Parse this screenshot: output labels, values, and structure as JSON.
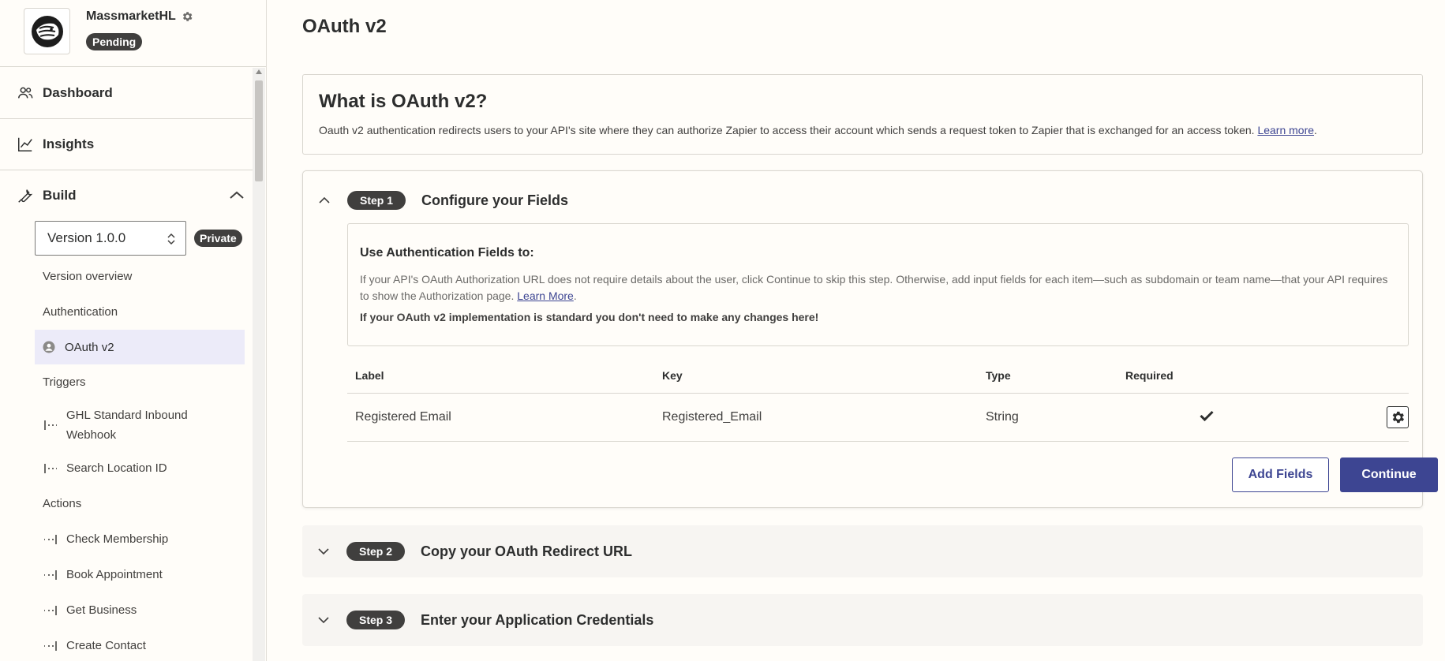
{
  "app": {
    "name": "MassmarketHL",
    "status": "Pending"
  },
  "nav": {
    "dashboard": "Dashboard",
    "insights": "Insights",
    "build": "Build"
  },
  "version": {
    "selected": "Version 1.0.0",
    "visibility": "Private"
  },
  "sidebar": {
    "version_overview": "Version overview",
    "authentication": "Authentication",
    "oauth": "OAuth v2",
    "triggers": "Triggers",
    "trigger_items": [
      "GHL Standard Inbound Webhook",
      "Search Location ID"
    ],
    "actions": "Actions",
    "action_items": [
      "Check Membership",
      "Book Appointment",
      "Get Business",
      "Create Contact"
    ]
  },
  "page": {
    "title": "OAuth v2"
  },
  "what": {
    "heading": "What is OAuth v2?",
    "description": "Oauth v2 authentication redirects users to your API's site where they can authorize Zapier to access their account which sends a request token to Zapier that is exchanged for an access token.",
    "link": "Learn more",
    "trailing": "."
  },
  "step1": {
    "badge": "Step 1",
    "title": "Configure your Fields",
    "box_heading": "Use Authentication Fields to:",
    "box_desc": "If your API's OAuth Authorization URL does not require details about the user, click Continue to skip this step. Otherwise, add input fields for each item—such as subdomain or team name—that your API requires to show the Authorization page.",
    "box_link": "Learn More",
    "box_trailing": ".",
    "box_note": "If your OAuth v2 implementation is standard you don't need to make any changes here!",
    "table": {
      "headers": {
        "label": "Label",
        "key": "Key",
        "type": "Type",
        "required": "Required"
      },
      "rows": [
        {
          "label": "Registered Email",
          "key": "Registered_Email",
          "type": "String",
          "required": true
        }
      ]
    },
    "add_fields": "Add Fields",
    "continue": "Continue"
  },
  "step2": {
    "badge": "Step 2",
    "title": "Copy your OAuth Redirect URL"
  },
  "step3": {
    "badge": "Step 3",
    "title": "Enter your Application Credentials"
  },
  "colors": {
    "accent": "#3d4592",
    "badge_bg": "#403f3e",
    "active_nav_bg": "#ecebf9",
    "page_bg": "#fffdf9"
  },
  "icons": {
    "dashboard": "people-icon",
    "insights": "line-chart-icon",
    "build": "wrench-icon",
    "settings": "gear-icon",
    "oauth": "user-circle-icon",
    "required": "checkmark-icon"
  }
}
